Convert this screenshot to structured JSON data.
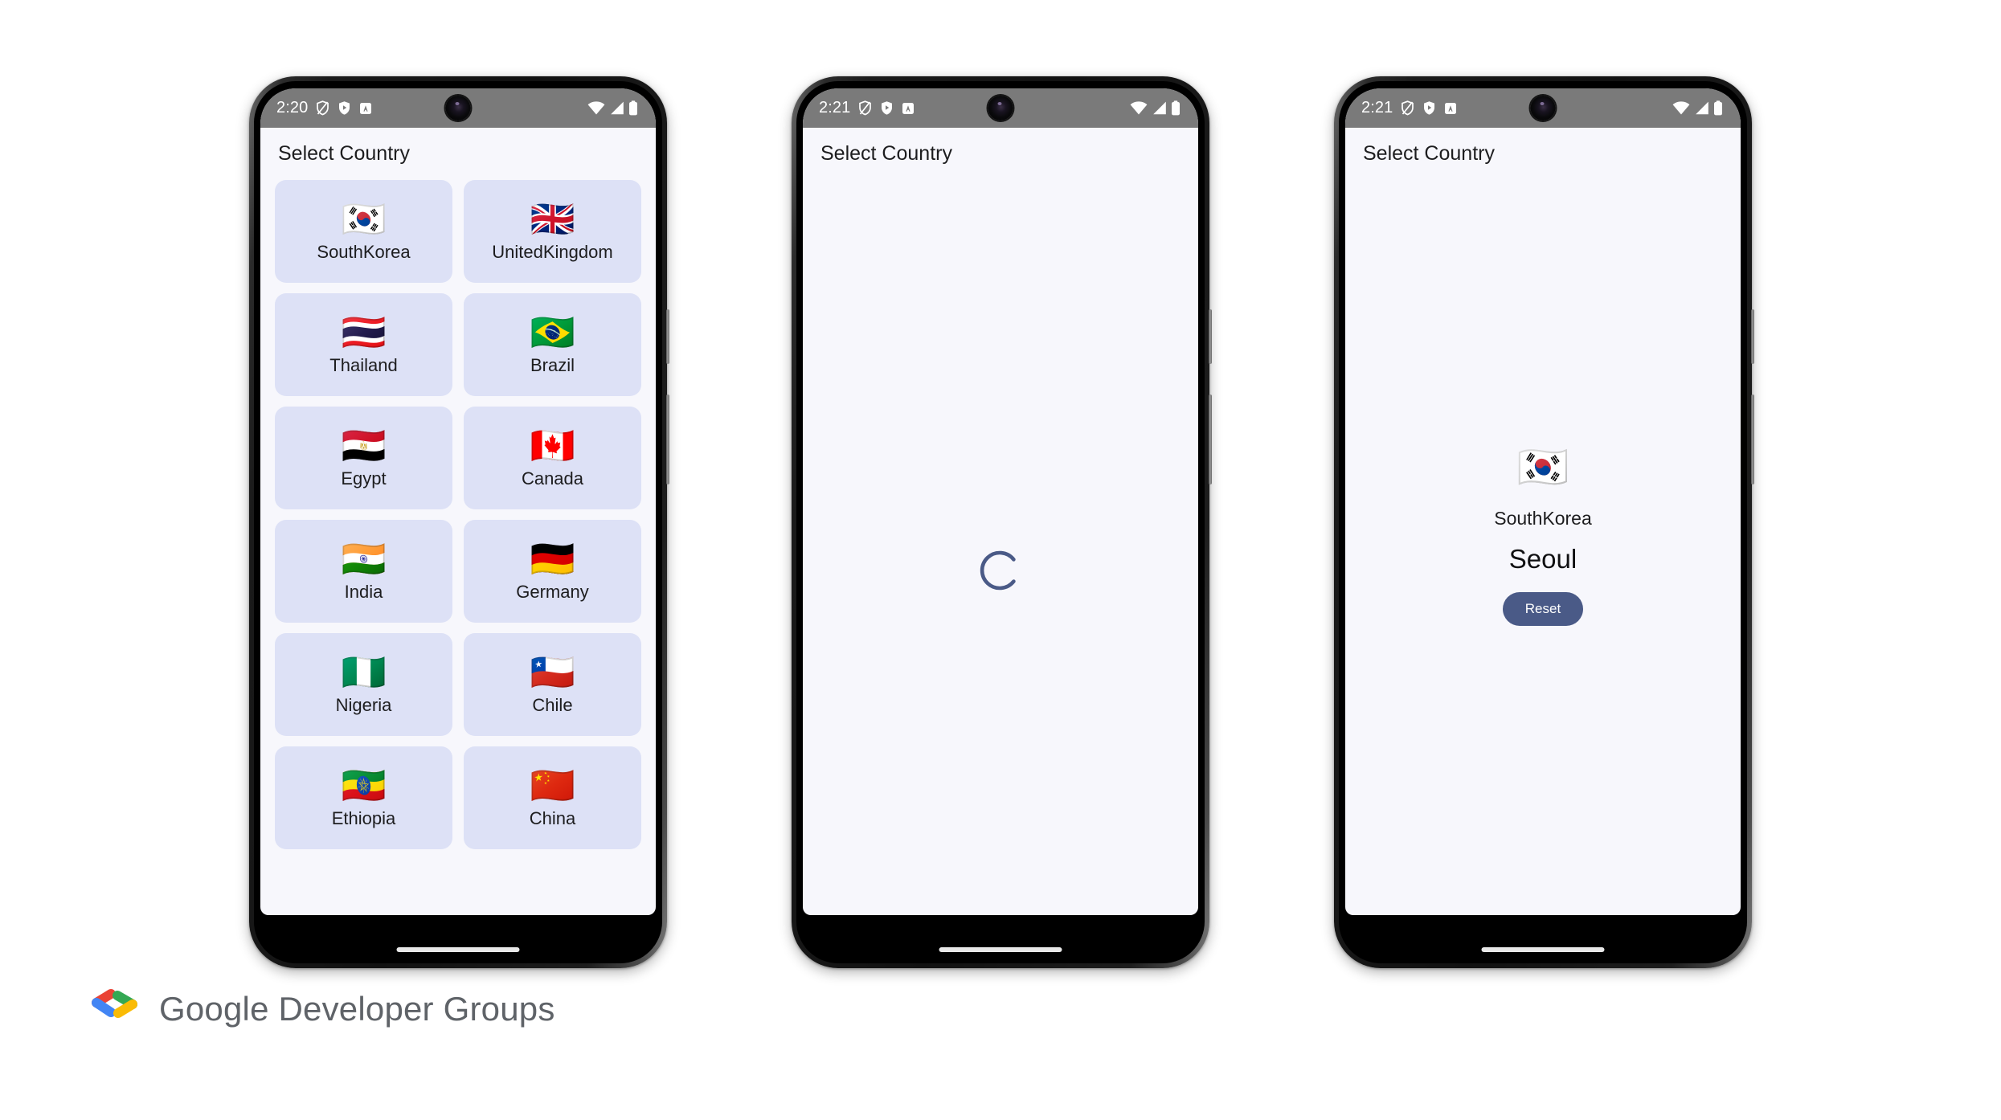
{
  "app": {
    "title": "Select Country"
  },
  "colors": {
    "screen_background": "#f7f7fc",
    "card_background": "#dde1f6",
    "accent": "#4a5a87",
    "statusbar_background": "#7a7a7a",
    "text_primary": "#1d1d1f",
    "footer_text": "#5f6368"
  },
  "phones": [
    {
      "id": "phone-list",
      "status_bar": {
        "time": "2:20",
        "left_icons": [
          "shield-slash-icon",
          "shield-play-icon",
          "app-badge-icon"
        ],
        "right_icons": [
          "wifi-icon",
          "cellular-signal-icon",
          "battery-icon"
        ]
      },
      "screen": "country-grid"
    },
    {
      "id": "phone-loading",
      "status_bar": {
        "time": "2:21",
        "left_icons": [
          "shield-slash-icon",
          "shield-play-icon",
          "app-badge-icon"
        ],
        "right_icons": [
          "wifi-icon",
          "cellular-signal-icon",
          "battery-icon"
        ]
      },
      "screen": "loading"
    },
    {
      "id": "phone-result",
      "status_bar": {
        "time": "2:21",
        "left_icons": [
          "shield-slash-icon",
          "shield-play-icon",
          "app-badge-icon"
        ],
        "right_icons": [
          "wifi-icon",
          "cellular-signal-icon",
          "battery-icon"
        ]
      },
      "screen": "result"
    }
  ],
  "countries": [
    {
      "name": "SouthKorea",
      "flag": "🇰🇷"
    },
    {
      "name": "UnitedKingdom",
      "flag": "🇬🇧"
    },
    {
      "name": "Thailand",
      "flag": "🇹🇭"
    },
    {
      "name": "Brazil",
      "flag": "🇧🇷"
    },
    {
      "name": "Egypt",
      "flag": "🇪🇬"
    },
    {
      "name": "Canada",
      "flag": "🇨🇦"
    },
    {
      "name": "India",
      "flag": "🇮🇳"
    },
    {
      "name": "Germany",
      "flag": "🇩🇪"
    },
    {
      "name": "Nigeria",
      "flag": "🇳🇬"
    },
    {
      "name": "Chile",
      "flag": "🇨🇱"
    },
    {
      "name": "Ethiopia",
      "flag": "🇪🇹"
    },
    {
      "name": "China",
      "flag": "🇨🇳"
    }
  ],
  "loading": {
    "spinner_color": "#4a5a87"
  },
  "result": {
    "flag": "🇰🇷",
    "country": "SouthKorea",
    "city": "Seoul",
    "reset_label": "Reset"
  },
  "footer": {
    "text": "Google Developer Groups",
    "logo_colors": {
      "red": "#ea4335",
      "blue": "#4285f4",
      "green": "#34a853",
      "yellow": "#fabb05"
    }
  }
}
